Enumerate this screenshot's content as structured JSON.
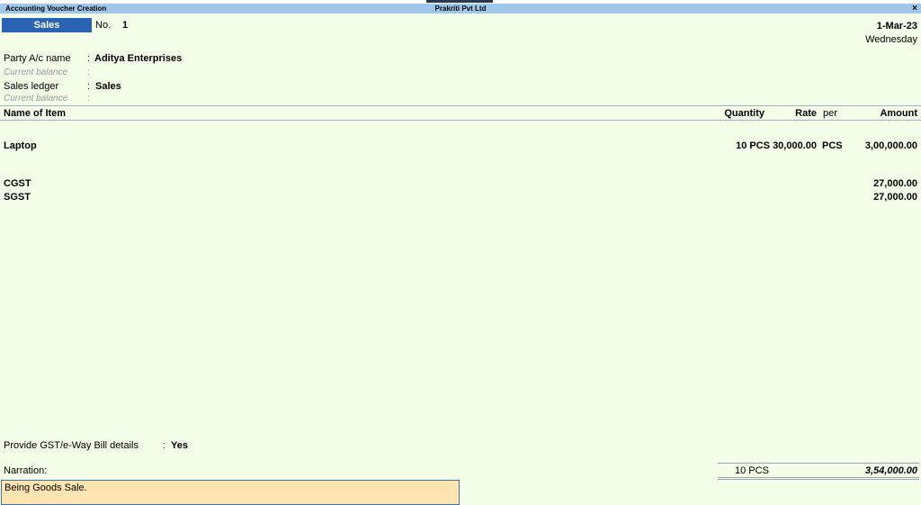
{
  "window": {
    "title_left": "Accounting Voucher Creation",
    "title_center": "Prakriti Pvt Ltd",
    "close_glyph": "×"
  },
  "voucher": {
    "type": "Sales",
    "no_label": "No.",
    "no_value": "1",
    "date": "1-Mar-23",
    "day": "Wednesday"
  },
  "party": {
    "label": "Party A/c name",
    "colon": ":",
    "value": "Aditya Enterprises",
    "balance_label": "Current balance",
    "balance_colon": ":"
  },
  "sales_ledger": {
    "label": "Sales ledger",
    "colon": ":",
    "value": "Sales",
    "balance_label": "Current balance",
    "balance_colon": ":"
  },
  "table": {
    "headers": {
      "name": "Name of Item",
      "quantity": "Quantity",
      "rate": "Rate",
      "per": "per",
      "amount": "Amount"
    },
    "items": [
      {
        "name": "Laptop",
        "quantity": "10 PCS",
        "rate": "30,000.00",
        "per": "PCS",
        "amount": "3,00,000.00"
      }
    ],
    "taxes": [
      {
        "name": "CGST",
        "amount": "27,000.00"
      },
      {
        "name": "SGST",
        "amount": "27,000.00"
      }
    ]
  },
  "gst": {
    "label": "Provide GST/e-Way Bill details",
    "colon": ":",
    "value": "Yes"
  },
  "narration": {
    "label": "Narration:",
    "value": "Being Goods Sale."
  },
  "totals": {
    "quantity": "10 PCS",
    "amount": "3,54,000.00"
  }
}
